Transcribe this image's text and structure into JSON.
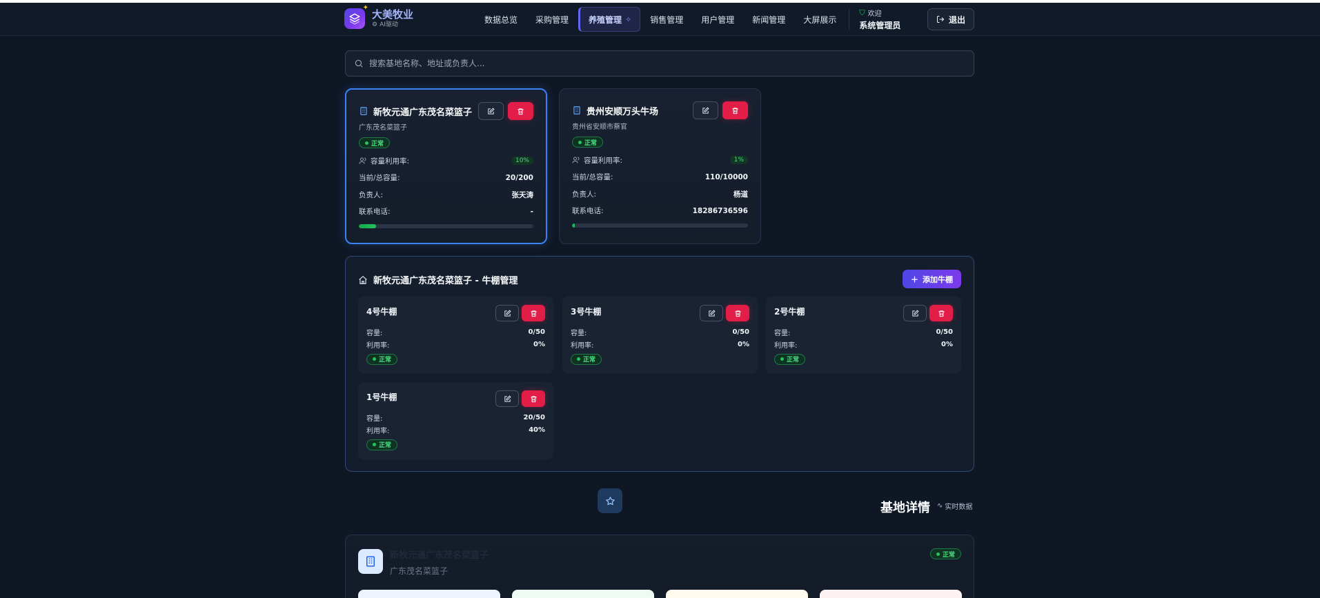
{
  "brand": {
    "name": "大美牧业",
    "sub": "AI驱动"
  },
  "nav": [
    {
      "label": "数据总览"
    },
    {
      "label": "采购管理"
    },
    {
      "label": "养殖管理"
    },
    {
      "label": "销售管理"
    },
    {
      "label": "用户管理"
    },
    {
      "label": "新闻管理"
    },
    {
      "label": "大屏展示"
    }
  ],
  "user": {
    "welcome": "欢迎",
    "name": "系统管理员",
    "logout": "退出"
  },
  "search": {
    "placeholder": "搜索基地名称、地址或负责人..."
  },
  "bases": [
    {
      "name": "新牧元通广东茂名菜篮子",
      "address": "广东茂名菜篮子",
      "status": "正常",
      "util_label": "容量利用率:",
      "util_value": "10%",
      "capacity_label": "当前/总容量:",
      "capacity_value": "20/200",
      "owner_label": "负责人:",
      "owner_value": "张天涛",
      "phone_label": "联系电话:",
      "phone_value": "-",
      "progress": 0.1
    },
    {
      "name": "贵州安顺万头牛场",
      "address": "贵州省安顺市蔡官",
      "status": "正常",
      "util_label": "容量利用率:",
      "util_value": "1%",
      "capacity_label": "当前/总容量:",
      "capacity_value": "110/10000",
      "owner_label": "负责人:",
      "owner_value": "杨道",
      "phone_label": "联系电话:",
      "phone_value": "18286736596",
      "progress": 0.011
    }
  ],
  "shed_panel": {
    "title": "新牧元通广东茂名菜篮子 - 牛棚管理",
    "add_label": "添加牛棚",
    "sheds": [
      {
        "name": "4号牛棚",
        "cap_label": "容量:",
        "cap": "0/50",
        "util_label": "利用率:",
        "util": "0%",
        "status": "正常"
      },
      {
        "name": "3号牛棚",
        "cap_label": "容量:",
        "cap": "0/50",
        "util_label": "利用率:",
        "util": "0%",
        "status": "正常"
      },
      {
        "name": "2号牛棚",
        "cap_label": "容量:",
        "cap": "0/50",
        "util_label": "利用率:",
        "util": "0%",
        "status": "正常"
      },
      {
        "name": "1号牛棚",
        "cap_label": "容量:",
        "cap": "20/50",
        "util_label": "利用率:",
        "util": "40%",
        "status": "正常"
      }
    ]
  },
  "detail": {
    "title": "基地详情",
    "realtime": "实时数据",
    "name": "新牧元通广东茂名菜篮子",
    "address": "广东茂名菜篮子",
    "status": "正常"
  },
  "colors": {
    "accent": "#6366f1",
    "danger": "#e11d48",
    "success": "#22c55e",
    "selected_border": "#3b82f6"
  }
}
